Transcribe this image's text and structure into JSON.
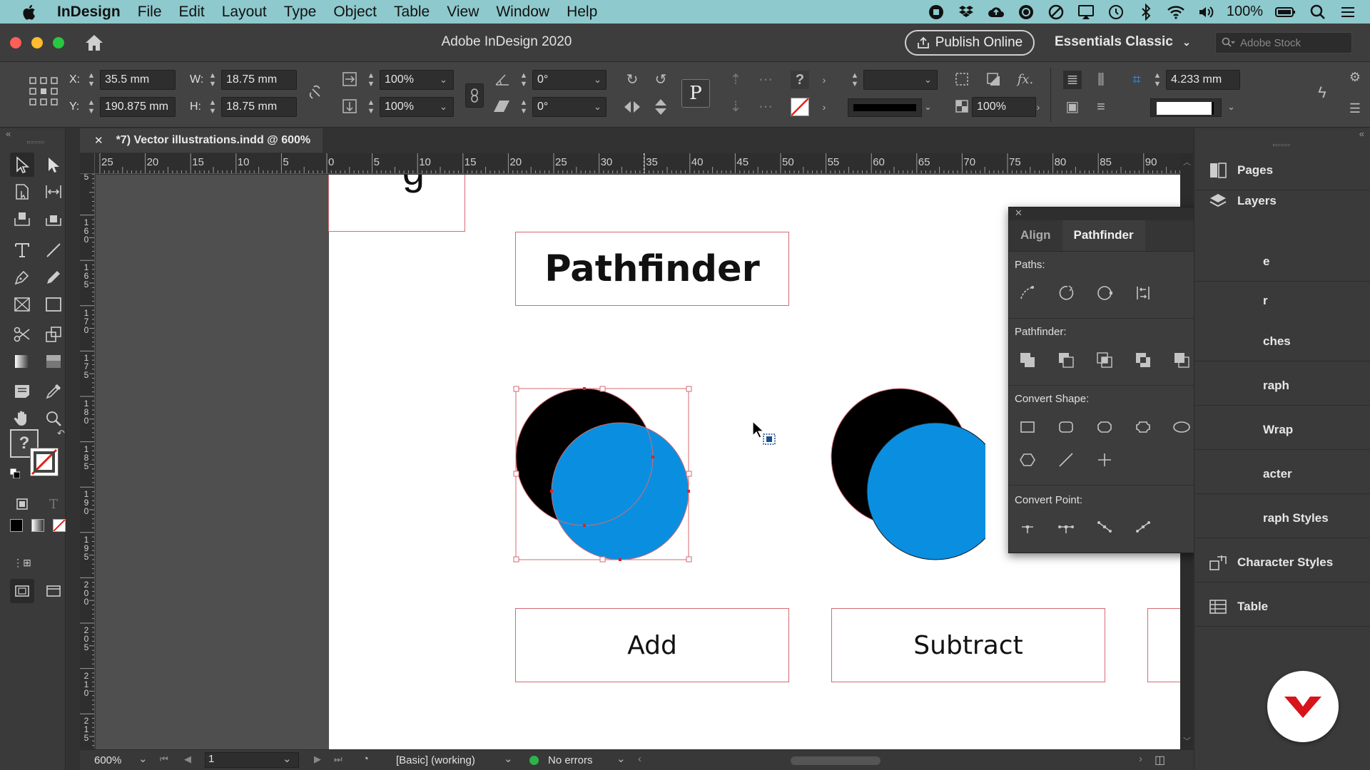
{
  "menubar": {
    "app_name": "InDesign",
    "items": [
      "File",
      "Edit",
      "Layout",
      "Type",
      "Object",
      "Table",
      "View",
      "Window",
      "Help"
    ],
    "battery": "100%"
  },
  "titlebar": {
    "title": "Adobe InDesign 2020",
    "publish_label": "Publish Online",
    "workspace_label": "Essentials Classic",
    "stock_placeholder": "Adobe Stock"
  },
  "control": {
    "x_label": "X:",
    "x_value": "35.5 mm",
    "y_label": "Y:",
    "y_value": "190.875 mm",
    "w_label": "W:",
    "w_value": "18.75 mm",
    "h_label": "H:",
    "h_value": "18.75 mm",
    "scale_x": "100%",
    "scale_y": "100%",
    "rotate": "0°",
    "shear": "0°",
    "stroke_pct": "100%",
    "spacing_value": "4.233 mm"
  },
  "document_tab": {
    "title": "*7) Vector illustrations.indd @ 600%"
  },
  "rulers": {
    "horizontal": [
      "25",
      "20",
      "15",
      "10",
      "5",
      "0",
      "5",
      "10",
      "15",
      "20",
      "25",
      "30",
      "35",
      "40",
      "45",
      "50",
      "55",
      "60",
      "65",
      "70",
      "75",
      "80",
      "85",
      "90"
    ],
    "vertical": [
      "5",
      "160",
      "165",
      "170",
      "175",
      "180",
      "185",
      "190",
      "195",
      "200",
      "205",
      "210",
      "215"
    ]
  },
  "canvas": {
    "heading": "Pathfinder",
    "label_add": "Add",
    "label_subtract": "Subtract",
    "fragment_glyph": "g",
    "colors": {
      "black_circle": "#000000",
      "blue_circle": "#0a8fe0",
      "frame": "#d46a72"
    }
  },
  "pathfinder_panel": {
    "tabs": [
      "Align",
      "Pathfinder"
    ],
    "active_tab": "Pathfinder",
    "sections": {
      "paths": "Paths:",
      "pathfinder": "Pathfinder:",
      "convert_shape": "Convert Shape:",
      "convert_point": "Convert Point:"
    }
  },
  "dock": {
    "items": [
      "Pages",
      "Layers",
      "e",
      "r",
      "ches",
      "raph",
      "Wrap",
      "acter",
      "raph Styles",
      "Character Styles",
      "Table"
    ]
  },
  "status": {
    "zoom": "600%",
    "page": "1",
    "style": "[Basic] (working)",
    "errors": "No errors"
  }
}
